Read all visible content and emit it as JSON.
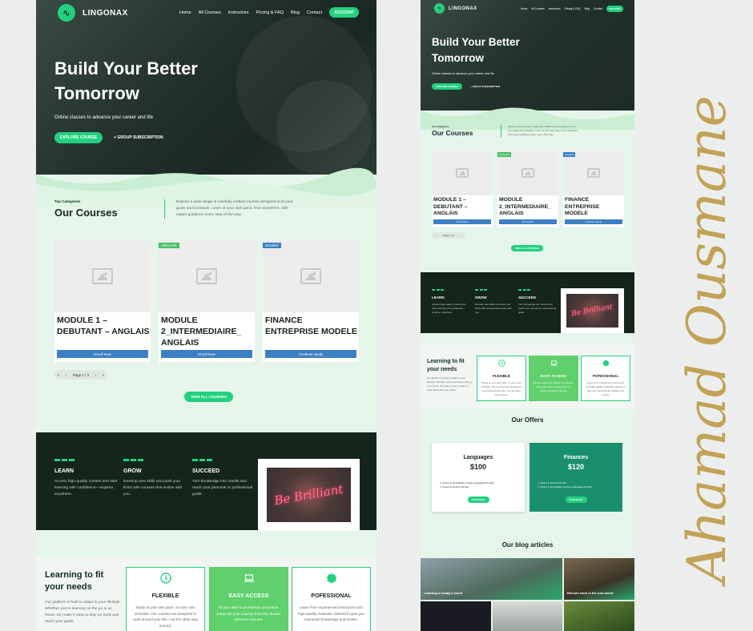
{
  "brand": "LINGONAX",
  "nav": [
    "Home",
    "All Courses",
    "Instructors",
    "Pricing & FAQ",
    "Blog",
    "Contact"
  ],
  "account": "ACCOUNT",
  "hero": {
    "title": "Build Your Better Tomorrow",
    "subtitle": "Online classes to advance your career and life",
    "cta_primary": "EXPLORE COURSE",
    "cta_secondary": "GROUP SUBSCRIPTION"
  },
  "courses": {
    "kicker": "Top Categories",
    "title": "Our Courses",
    "description": "Explore a wide range of carefully crafted courses designed to fit your goals and schedule. Learn at your own pace, from anywhere, with expert guidance every step of the way.",
    "items": [
      {
        "title": "MODULE 1 – DEBUTANT – ANGLAIS",
        "badge": "",
        "button": "Enroll Now"
      },
      {
        "title": "MODULE 2_INTERMEDIAIRE_ ANGLAIS",
        "badge": "ANGLAIS",
        "button": "Enroll Now"
      },
      {
        "title": "FINANCE ENTREPRISE MODELE",
        "badge": "Enrolled",
        "button": "Continue Study"
      }
    ],
    "pager": "Page 1 / 2",
    "view_all": "VIEW ALL COURSES"
  },
  "pillars": [
    {
      "title": "LEARN",
      "text": "Access high-quality content and start learning with confidence—anytime, anywhere."
    },
    {
      "title": "GROW",
      "text": "Develop new skills and push your limits with courses that evolve with you."
    },
    {
      "title": "SUCCEED",
      "text": "Turn knowledge into results and reach your personal or professional goals."
    }
  ],
  "neon_text": "Be Brilliant",
  "fit": {
    "title": "Learning to fit your needs",
    "text": "Our platform is built to adapt to your lifestyle. Whether you're learning on the go or at home, we make it easy to stay on track and reach your goals.",
    "boxes": [
      {
        "title": "FLEXIBLE",
        "text": "Study at your own pace, on your own schedule. Our courses are designed to work around your life—not the other way around."
      },
      {
        "title": "EASY ACCESS",
        "text": "All you need is an internet connection. Jump into your courses from any device, wherever you are."
      },
      {
        "title": "POFESSIONAL",
        "text": "Learn from experienced instructors and high-quality materials, tailored to give you real-world knowledge and results."
      }
    ]
  },
  "offers": {
    "title": "Our Offers",
    "items": [
      {
        "name": "Languages",
        "price": "$100",
        "features": [
          "Access to all available courses (Languages Domain)",
          "Access to Finance Domain"
        ],
        "button": "PURCHASE"
      },
      {
        "name": "Finances",
        "price": "$120",
        "features": [
          "Access to Finance Domain",
          "Access to all available courses (Languages Domain)"
        ],
        "button": "PURCHASE"
      }
    ]
  },
  "blog": {
    "title": "Our blog articles",
    "posts": [
      "Learning in today's world",
      "Remote work in the new world"
    ]
  },
  "signature": "Ahamad Ousmane",
  "colors": {
    "accent": "#22d07f",
    "dark": "#14251c",
    "blue": "#3b7fc5",
    "gold": "#c2a256"
  }
}
